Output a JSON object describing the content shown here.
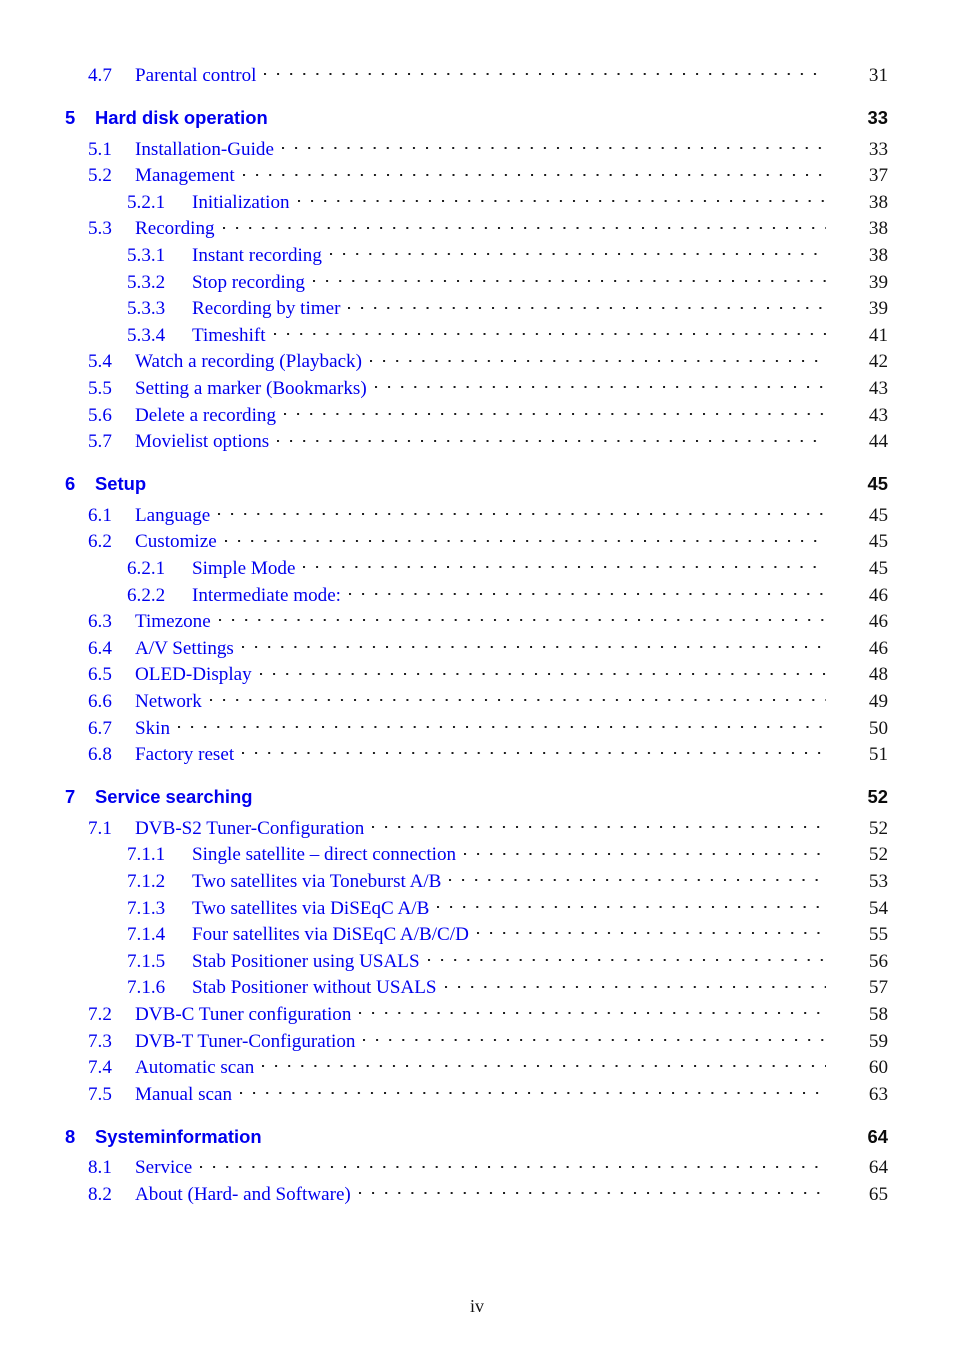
{
  "document": {
    "folio": "iv",
    "link_color": "#0000ee",
    "text_color": "#141414"
  },
  "toc": {
    "entries": [
      {
        "level": "section",
        "num": "4.7",
        "title": "Parental control",
        "page": "31"
      },
      {
        "level": "chapter",
        "num": "5",
        "title": "Hard disk operation",
        "page": "33"
      },
      {
        "level": "section",
        "num": "5.1",
        "title": "Installation-Guide",
        "page": "33"
      },
      {
        "level": "section",
        "num": "5.2",
        "title": "Management",
        "page": "37"
      },
      {
        "level": "subsection",
        "num": "5.2.1",
        "title": "Initialization",
        "page": "38"
      },
      {
        "level": "section",
        "num": "5.3",
        "title": "Recording",
        "page": "38"
      },
      {
        "level": "subsection",
        "num": "5.3.1",
        "title": "Instant recording",
        "page": "38"
      },
      {
        "level": "subsection",
        "num": "5.3.2",
        "title": "Stop recording",
        "page": "39"
      },
      {
        "level": "subsection",
        "num": "5.3.3",
        "title": "Recording by timer",
        "page": "39"
      },
      {
        "level": "subsection",
        "num": "5.3.4",
        "title": "Timeshift",
        "page": "41"
      },
      {
        "level": "section",
        "num": "5.4",
        "title": "Watch a recording (Playback)",
        "page": "42"
      },
      {
        "level": "section",
        "num": "5.5",
        "title": "Setting a marker (Bookmarks)",
        "page": "43"
      },
      {
        "level": "section",
        "num": "5.6",
        "title": "Delete a recording",
        "page": "43"
      },
      {
        "level": "section",
        "num": "5.7",
        "title": "Movielist options",
        "page": "44"
      },
      {
        "level": "chapter",
        "num": "6",
        "title": "Setup",
        "page": "45"
      },
      {
        "level": "section",
        "num": "6.1",
        "title": "Language",
        "page": "45"
      },
      {
        "level": "section",
        "num": "6.2",
        "title": "Customize",
        "page": "45"
      },
      {
        "level": "subsection",
        "num": "6.2.1",
        "title": "Simple Mode",
        "page": "45"
      },
      {
        "level": "subsection",
        "num": "6.2.2",
        "title": "Intermediate mode:",
        "page": "46"
      },
      {
        "level": "section",
        "num": "6.3",
        "title": "Timezone",
        "page": "46"
      },
      {
        "level": "section",
        "num": "6.4",
        "title": "A/V Settings",
        "page": "46"
      },
      {
        "level": "section",
        "num": "6.5",
        "title": "OLED-Display",
        "page": "48"
      },
      {
        "level": "section",
        "num": "6.6",
        "title": "Network",
        "page": "49"
      },
      {
        "level": "section",
        "num": "6.7",
        "title": "Skin",
        "page": "50"
      },
      {
        "level": "section",
        "num": "6.8",
        "title": "Factory reset",
        "page": "51"
      },
      {
        "level": "chapter",
        "num": "7",
        "title": "Service searching",
        "page": "52"
      },
      {
        "level": "section",
        "num": "7.1",
        "title": "DVB-S2 Tuner-Configuration",
        "page": "52"
      },
      {
        "level": "subsection",
        "num": "7.1.1",
        "title": "Single satellite – direct connection",
        "page": "52"
      },
      {
        "level": "subsection",
        "num": "7.1.2",
        "title": "Two satellites via Toneburst A/B",
        "page": "53"
      },
      {
        "level": "subsection",
        "num": "7.1.3",
        "title": "Two satellites via DiSEqC A/B",
        "page": "54"
      },
      {
        "level": "subsection",
        "num": "7.1.4",
        "title": "Four satellites via DiSEqC A/B/C/D",
        "page": "55"
      },
      {
        "level": "subsection",
        "num": "7.1.5",
        "title": "Stab Positioner using USALS",
        "page": "56"
      },
      {
        "level": "subsection",
        "num": "7.1.6",
        "title": "Stab Positioner without USALS",
        "page": "57"
      },
      {
        "level": "section",
        "num": "7.2",
        "title": "DVB-C Tuner configuration",
        "page": "58"
      },
      {
        "level": "section",
        "num": "7.3",
        "title": "DVB-T Tuner-Configuration",
        "page": "59"
      },
      {
        "level": "section",
        "num": "7.4",
        "title": "Automatic scan",
        "page": "60"
      },
      {
        "level": "section",
        "num": "7.5",
        "title": "Manual scan",
        "page": "63"
      },
      {
        "level": "chapter",
        "num": "8",
        "title": "Systeminformation",
        "page": "64"
      },
      {
        "level": "section",
        "num": "8.1",
        "title": "Service",
        "page": "64"
      },
      {
        "level": "section",
        "num": "8.2",
        "title": "About (Hard- and Software)",
        "page": "65"
      }
    ]
  }
}
